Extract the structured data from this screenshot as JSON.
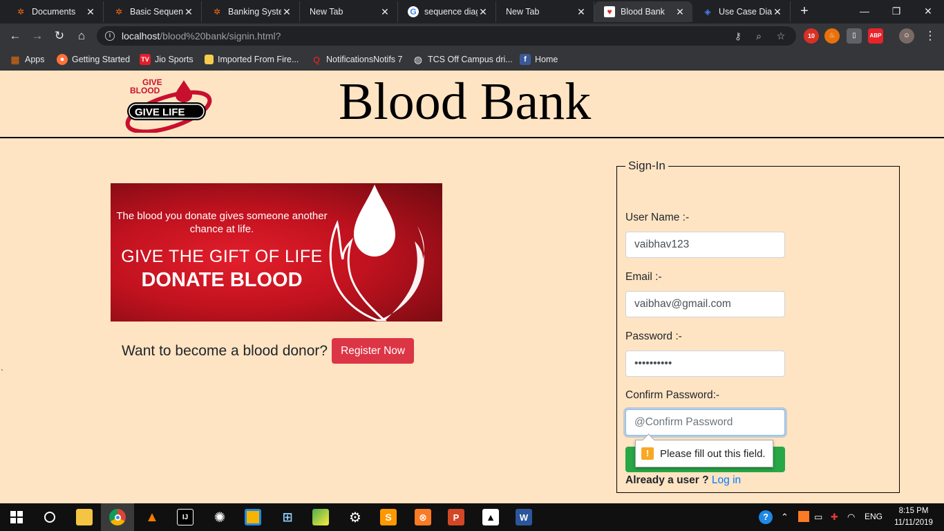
{
  "browser": {
    "tabs": [
      {
        "title": "Documents",
        "icon": "lucidchart-icon",
        "color": "#f96b13"
      },
      {
        "title": "Basic Sequence",
        "icon": "lucidchart-icon",
        "color": "#f96b13"
      },
      {
        "title": "Banking System",
        "icon": "lucidchart-icon",
        "color": "#f96b13"
      },
      {
        "title": "New Tab",
        "icon": "none",
        "color": "#35363a"
      },
      {
        "title": "sequence diag",
        "icon": "google-icon",
        "color": "#ffffff"
      },
      {
        "title": "New Tab",
        "icon": "none",
        "color": "#35363a"
      },
      {
        "title": "Blood Bank",
        "icon": "blood-drop-icon",
        "color": "#d32f2f"
      },
      {
        "title": "Use Case Diag",
        "icon": "diagram-icon",
        "color": "#4285f4"
      }
    ],
    "tab_close_glyph": "✕",
    "new_tab_glyph": "+",
    "window_controls": {
      "minimize": "—",
      "restore": "❐",
      "close": "✕"
    },
    "url": {
      "host": "localhost",
      "path": "/blood%20bank/signin.html?"
    },
    "nav": {
      "back": "←",
      "forward": "→",
      "reload": "↻",
      "home": "⌂"
    },
    "extensions": [
      {
        "name": "gmail-badge-icon",
        "badge": "10",
        "color": "#d93025"
      },
      {
        "name": "flame-extension-icon",
        "badge": "",
        "color": "#e8710a"
      },
      {
        "name": "bottle-extension-icon",
        "badge": "",
        "color": "#5f6368"
      },
      {
        "name": "adblock-icon",
        "badge": "ABP",
        "color": "#e8232a"
      }
    ],
    "bookmarks": [
      {
        "label": "Apps",
        "icon": "apps-grid-icon"
      },
      {
        "label": "Getting Started",
        "icon": "firefox-icon"
      },
      {
        "label": "Jio Sports",
        "icon": "jio-tv-icon"
      },
      {
        "label": "Imported From Fire...",
        "icon": "folder-icon"
      },
      {
        "label": "NotificationsNotifs 7",
        "icon": "quora-icon"
      },
      {
        "label": "TCS Off Campus dri...",
        "icon": "globe-icon"
      },
      {
        "label": "Home",
        "icon": "facebook-icon"
      }
    ]
  },
  "site": {
    "title": "Blood Bank",
    "logo": {
      "line1": "GIVE",
      "line2": "BLOOD",
      "line3": "GIVE LIFE"
    },
    "banner": {
      "line1": "The blood you donate gives someone another chance at life.",
      "line2": "GIVE THE GIFT OF LIFE",
      "line3": "DONATE BLOOD"
    },
    "donor_prompt": "Want to become a blood donor?",
    "register_button": "Register Now",
    "stray_char": "`"
  },
  "signin": {
    "legend": "Sign-In",
    "username": {
      "label": "User Name :-",
      "value": "vaibhav123"
    },
    "email": {
      "label": "Email :-",
      "value": "vaibhav@gmail.com"
    },
    "password": {
      "label": "Password :-",
      "value": "••••••••••"
    },
    "confirm": {
      "label": "Confirm Password:-",
      "placeholder": "@Confirm Password"
    },
    "validation_message": "Please fill out this field.",
    "already_user": "Already a user ?",
    "login_link": "Log in",
    "colors": {
      "submit": "#28a745",
      "register": "#dc3545",
      "link": "#007bff"
    }
  },
  "taskbar": {
    "apps": [
      {
        "name": "start-windows-icon"
      },
      {
        "name": "cortana-search-icon"
      },
      {
        "name": "file-explorer-icon"
      },
      {
        "name": "chrome-icon"
      },
      {
        "name": "vlc-icon"
      },
      {
        "name": "intellij-icon"
      },
      {
        "name": "aperture-app-icon"
      },
      {
        "name": "sticky-app-icon"
      },
      {
        "name": "network-app-icon"
      },
      {
        "name": "maps-app-icon"
      },
      {
        "name": "settings-gear-icon"
      },
      {
        "name": "sublime-text-icon"
      },
      {
        "name": "xampp-icon"
      },
      {
        "name": "powerpoint-icon"
      },
      {
        "name": "photos-icon"
      },
      {
        "name": "word-icon"
      }
    ],
    "language": "ENG",
    "time": "8:15 PM",
    "date": "11/11/2019"
  }
}
